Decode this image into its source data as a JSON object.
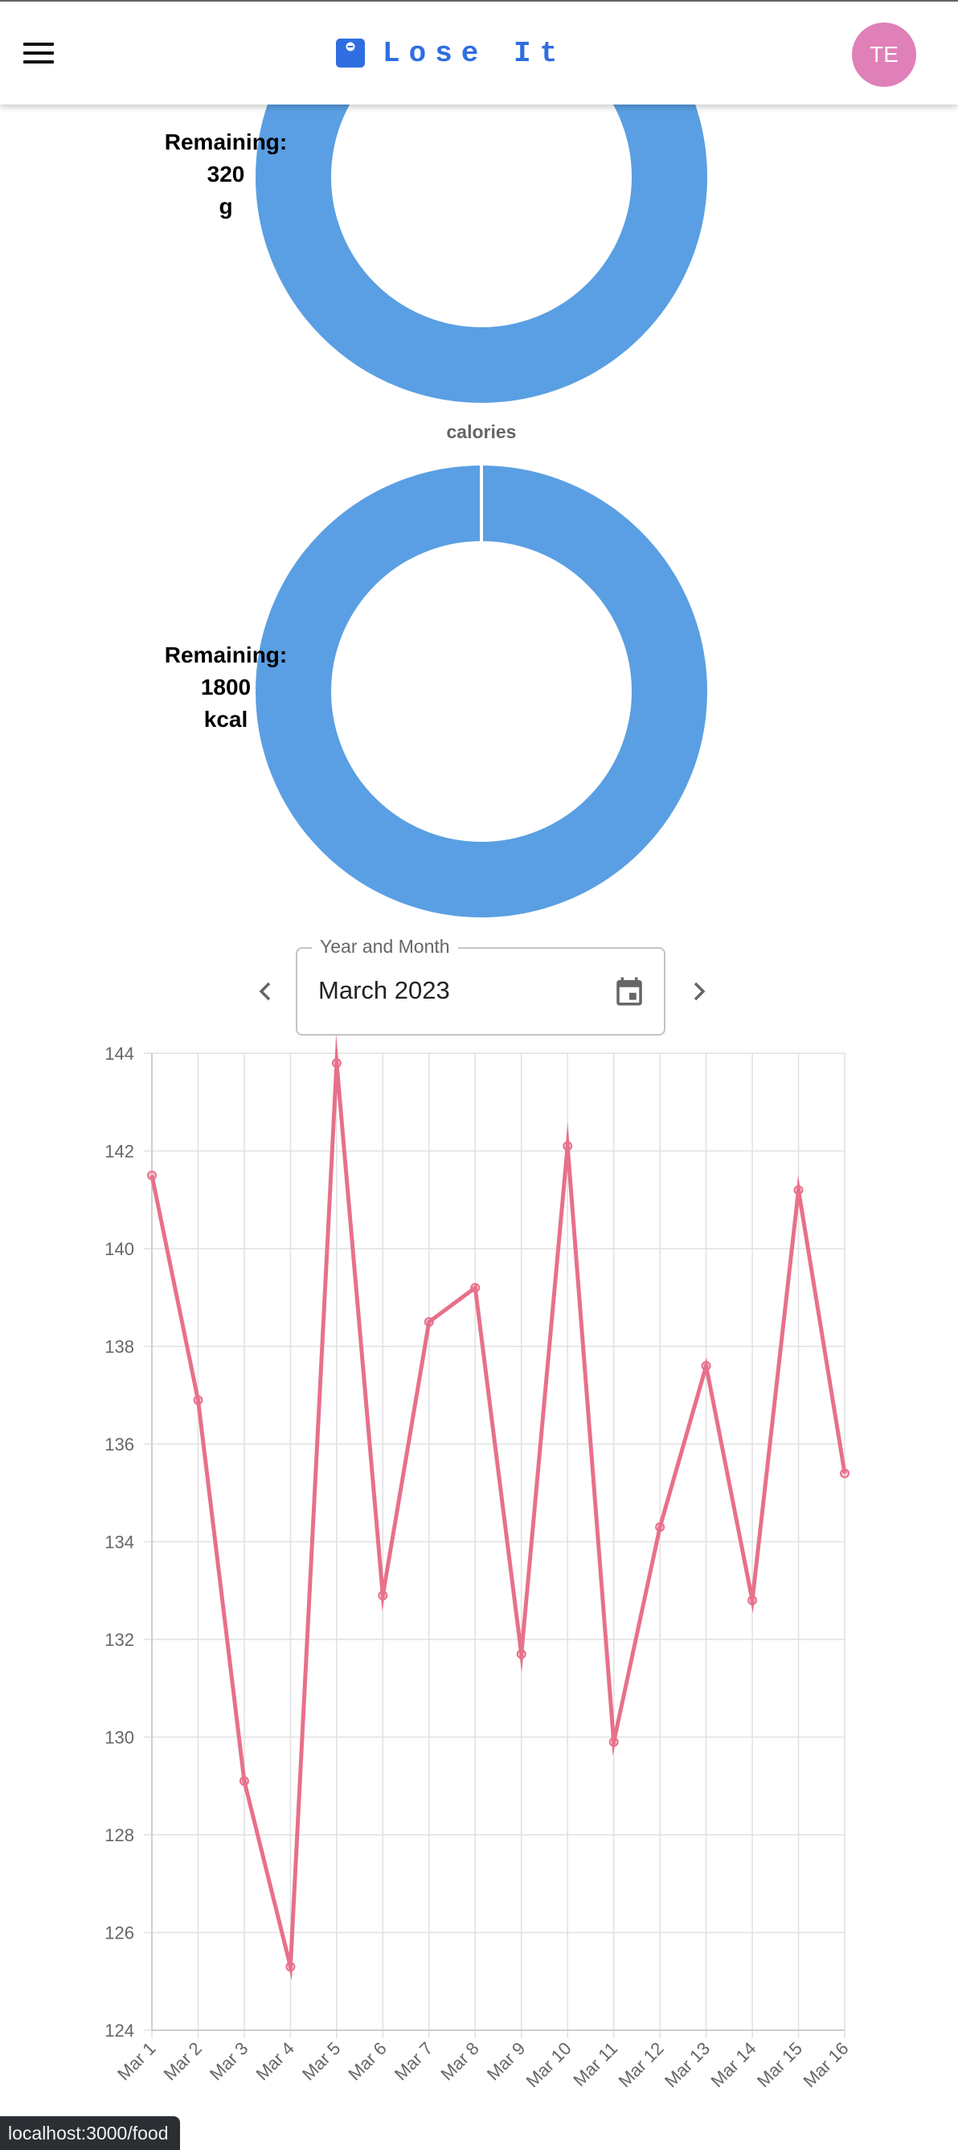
{
  "header": {
    "brand": "Lose It",
    "avatar_initials": "TE",
    "menu_icon": "hamburger-menu-icon",
    "brand_icon": "scale-icon",
    "brand_color": "#2f6ee0",
    "avatar_color": "#e080b8"
  },
  "donuts": {
    "carbs": {
      "remaining_label": "Remaining:",
      "value": "320",
      "unit": "g",
      "color": "#5a9fe3"
    },
    "calories": {
      "title": "calories",
      "remaining_label": "Remaining:",
      "value": "1800",
      "unit": "kcal",
      "color": "#5a9fe3"
    }
  },
  "month_picker": {
    "label": "Year and Month",
    "value": "March 2023",
    "prev_icon": "chevron-left-icon",
    "next_icon": "chevron-right-icon",
    "calendar_icon": "calendar-icon"
  },
  "chart_data": {
    "type": "line",
    "categories": [
      "Mar 1",
      "Mar 2",
      "Mar 3",
      "Mar 4",
      "Mar 5",
      "Mar 6",
      "Mar 7",
      "Mar 8",
      "Mar 9",
      "Mar 10",
      "Mar 11",
      "Mar 12",
      "Mar 13",
      "Mar 14",
      "Mar 15",
      "Mar 16"
    ],
    "series": [
      {
        "values": [
          141.5,
          136.9,
          129.1,
          125.3,
          143.8,
          132.9,
          138.5,
          139.2,
          131.7,
          142.1,
          129.9,
          134.3,
          137.6,
          132.8,
          141.2,
          135.4
        ],
        "color": "#e8708a"
      }
    ],
    "ylim": [
      124,
      144
    ],
    "yticks": [
      "124",
      "126",
      "128",
      "130",
      "132",
      "134",
      "136",
      "138",
      "140",
      "142",
      "144"
    ],
    "grid": true,
    "legend": "none"
  },
  "status_bar": {
    "url": "localhost:3000/food"
  }
}
